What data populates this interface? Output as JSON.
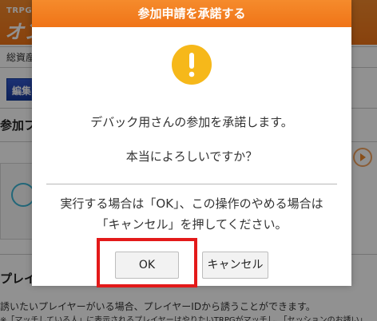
{
  "background": {
    "brand_small": "TRPG",
    "brand_main": "オン",
    "label_1": "総資産",
    "edit_button": "編集",
    "section_title": "参加フ",
    "player_heading": "プレイ",
    "text_line_1": "誘いたいプレイヤーがいる場合、プレイヤーIDから誘うことができます。",
    "text_line_2": "※「マッチしている人」に表示されるプレイヤーはやりたいTRPGがマッチし、「セッションのお誘い」"
  },
  "dialog": {
    "title": "参加申請を承諾する",
    "message_1": "デバック用さんの参加を承諾します。",
    "message_2": "本当によろしいですか？",
    "note_1": "実行する場合は「OK」、この操作のやめる場合は",
    "note_2": "「キャンセル」を押してください。",
    "ok_label": "OK",
    "cancel_label": "キャンセル"
  },
  "colors": {
    "header": "#f07417",
    "warning": "#f6b81a",
    "highlight": "#e31a1a",
    "edit_button": "#173a9c"
  },
  "icons": {
    "warning": "warning-exclamation-icon",
    "avatar": "user-avatar-icon",
    "arrow": "play-arrow-icon"
  }
}
